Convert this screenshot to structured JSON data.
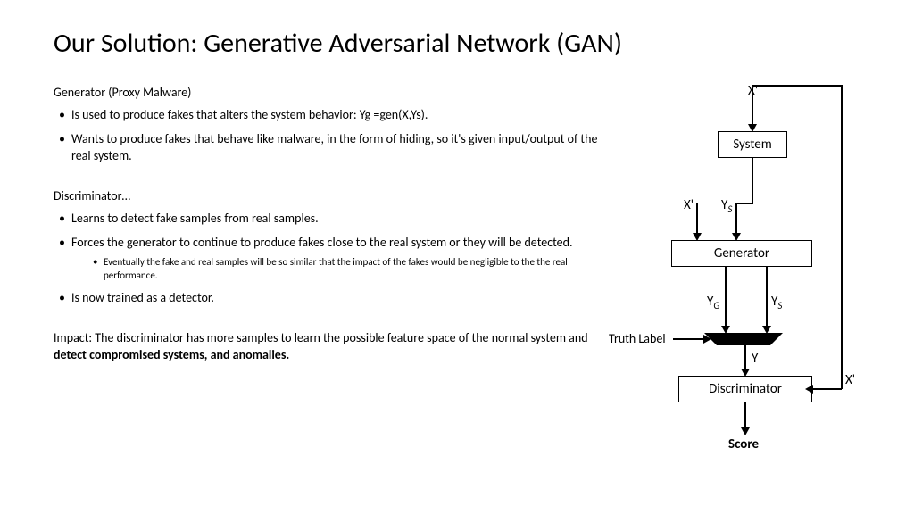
{
  "title": "Our Solution: Generative Adversarial Network (GAN)",
  "generator": {
    "heading": "Generator (Proxy Malware)",
    "bullets": [
      "Is used to produce fakes that alters the system behavior: Yg =gen(X,Ys).",
      "Wants to produce fakes that behave like malware, in the form of hiding, so it's given input/output of the real system."
    ]
  },
  "discriminator": {
    "heading": "Discriminator…",
    "bullets": [
      "Learns to detect fake samples from real samples.",
      "Forces the generator to continue to produce fakes close to the real system or they will be detected.",
      "Is now trained as a detector."
    ],
    "sub_bullet": "Eventually the fake and real samples will be so similar that the impact of the fakes would be negligible to the the real performance."
  },
  "impact": {
    "prefix": "Impact: The discriminator has more samples to learn the possible feature space of the normal system and ",
    "bold": "detect compromised systems, and anomalies."
  },
  "diagram": {
    "x_top": "X'",
    "system": "System",
    "x_left": "X'",
    "ys_in": "Y",
    "ys_in_sub": "S",
    "generator": "Generator",
    "yg": "Y",
    "yg_sub": "G",
    "ys_out": "Y",
    "ys_out_sub": "S",
    "truth_label": "Truth Label",
    "y_mid": "Y",
    "discriminator": "Discriminator",
    "x_right": "X'",
    "score": "Score"
  }
}
